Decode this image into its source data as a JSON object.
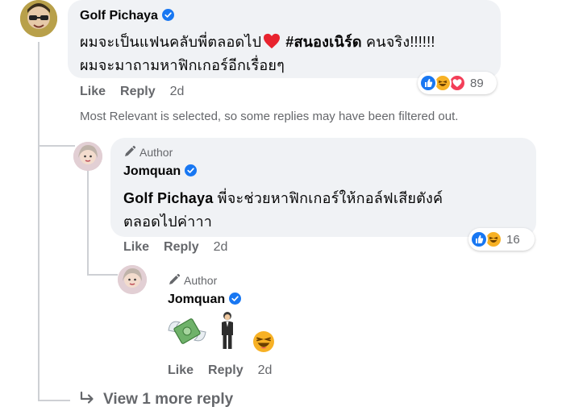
{
  "comment": {
    "author": "Golf Pichaya",
    "line1_text": "ผมจะเป็นแฟนคลับพี่ตลอดไป",
    "hashtag": "#สนองเนิร์ด",
    "line1_tail": "คนจริง!!!!!!",
    "line2": "ผมจะมาถามหาฟิกเกอร์อีกเรื่อยๆ",
    "like": "Like",
    "reply": "Reply",
    "time": "2d",
    "reaction_count": "89",
    "reaction_icons": [
      "like-icon",
      "haha-icon",
      "love-icon"
    ]
  },
  "notice": "Most Relevant is selected, so some replies may have been filtered out.",
  "reply1": {
    "tag": "Author",
    "author": "Jomquan",
    "mention": "Golf Pichaya",
    "line1_rest": "พี่จะช่วยหาฟิกเกอร์ให้กอล์ฟเสียตังค์",
    "line2": "ตลอดไปค่าาา",
    "like": "Like",
    "reply": "Reply",
    "time": "2d",
    "reaction_count": "16",
    "reaction_icons": [
      "like-icon",
      "haha-icon"
    ]
  },
  "reply2": {
    "tag": "Author",
    "author": "Jomquan",
    "stickers": [
      "flying-money-icon",
      "person-in-suit-icon",
      "haha-icon"
    ],
    "like": "Like",
    "reply": "Reply",
    "time": "2d"
  },
  "view_more": "View 1 more reply",
  "colors": {
    "bubble": "#f0f2f5",
    "secondary_text": "#65676b",
    "verified_blue": "#1877f2",
    "like_blue": "#1877f2",
    "haha_yellow": "#f7b125",
    "love_red": "#f33e58"
  }
}
